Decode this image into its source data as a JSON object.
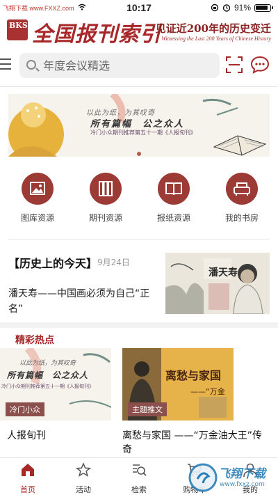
{
  "status_bar": {
    "watermark": "飞翔下载 www.FXXZ.com",
    "time": "10:17",
    "battery": "91%"
  },
  "header": {
    "logo_badge": "BKS",
    "title": "全国报刊索引",
    "slogan_cn": "见证近200年的历史变迁",
    "slogan_en": "Witnessing the Last 200 Years of Chinese History"
  },
  "search": {
    "placeholder": "年度会议精选"
  },
  "banner": {
    "line1": "以此为纸，为其叹奇",
    "line2": "所有篇幅　公之众人",
    "line3": "冷门小众期刊推荐第五十一期《人报旬刊》",
    "slide_count": 1,
    "active_slide": 0
  },
  "quick_links": [
    {
      "label": "图库资源",
      "icon": "image-icon"
    },
    {
      "label": "期刊资源",
      "icon": "books-icon"
    },
    {
      "label": "报纸资源",
      "icon": "open-book-icon"
    },
    {
      "label": "我的书房",
      "icon": "armchair-icon"
    }
  ],
  "today_in_history": {
    "title": "【历史上的今天】",
    "date": "9月24日",
    "description": "潘天寿——中国画必须为自己“正名”",
    "image_caption": "潘天寿"
  },
  "hot": {
    "section_title": "精彩热点",
    "cards": [
      {
        "tag": "冷门小众",
        "title": "人报旬刊"
      },
      {
        "tag": "主题推文",
        "title": "离愁与家国 ——“万金油大王”传奇",
        "image_text": "离愁与家国",
        "image_sub": "——“万金"
      }
    ]
  },
  "bottom_nav": [
    {
      "label": "首页",
      "icon": "home-icon",
      "active": true
    },
    {
      "label": "活动",
      "icon": "star-icon",
      "active": false
    },
    {
      "label": "检索",
      "icon": "search-list-icon",
      "active": false
    },
    {
      "label": "购物车",
      "icon": "cart-icon",
      "active": false
    },
    {
      "label": "我的",
      "icon": "user-icon",
      "active": false
    }
  ],
  "colors": {
    "brand": "#a8282a",
    "icon_circle": "#9c3a35",
    "tag": "#8b4f4c"
  },
  "corner_watermark": {
    "cn": "飞翔下载",
    "url": "www.fxxz.com"
  }
}
